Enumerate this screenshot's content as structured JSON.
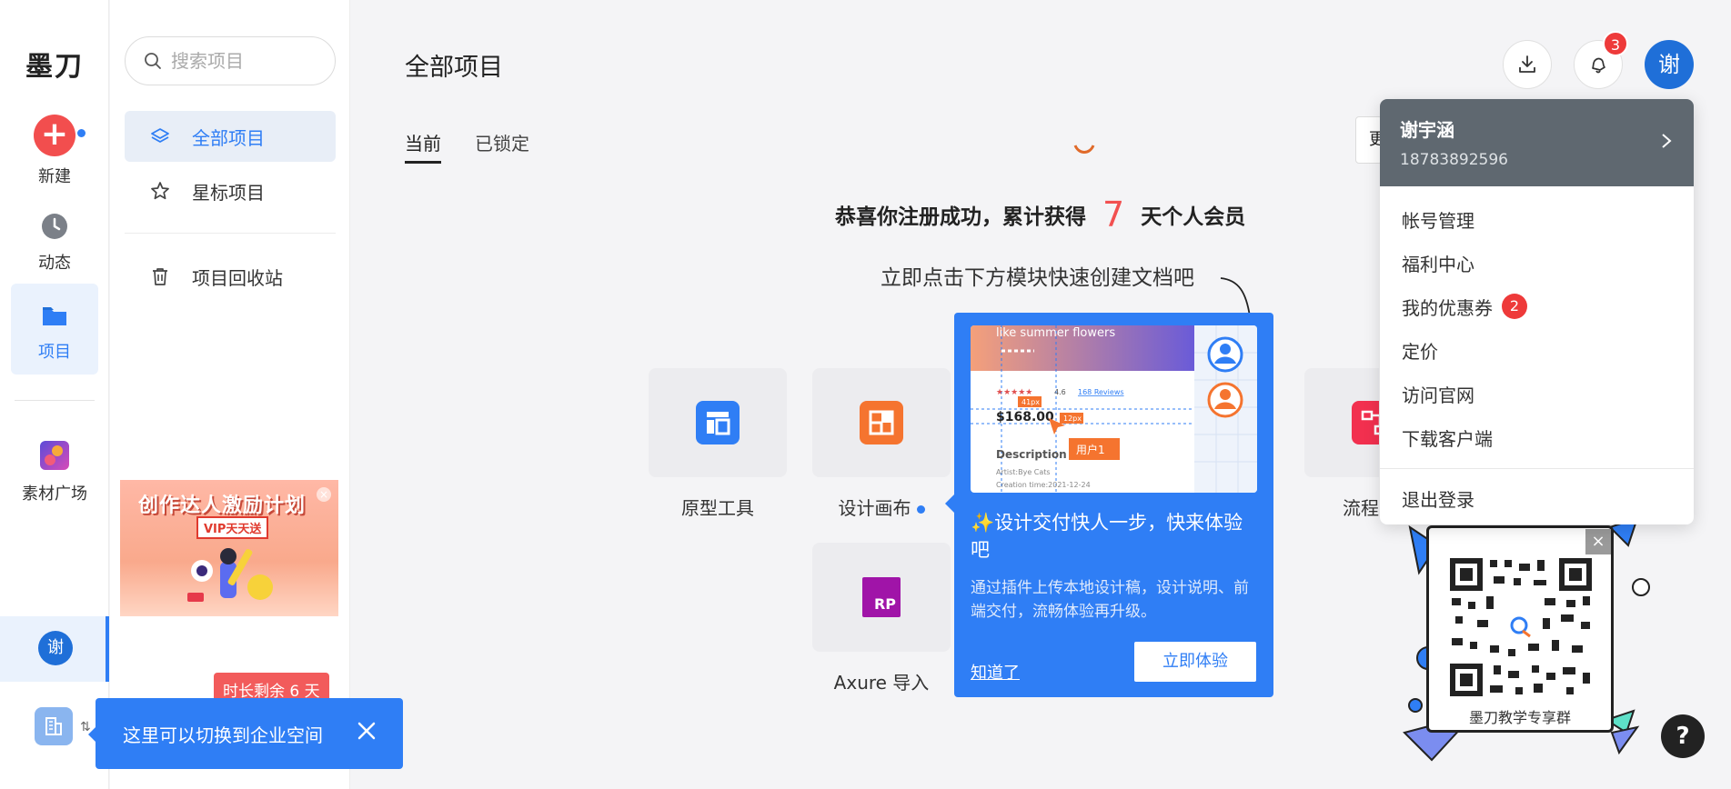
{
  "app": {
    "logo": "墨刀"
  },
  "rail": {
    "new_label": "新建",
    "activity_label": "动态",
    "projects_label": "项目",
    "assets_label": "素材广场",
    "user_avatar_text": "谢"
  },
  "sidebar": {
    "search_placeholder": "搜索项目",
    "items": [
      {
        "label": "全部项目",
        "icon": "layers-icon",
        "active": true
      },
      {
        "label": "星标项目",
        "icon": "star-icon",
        "active": false
      },
      {
        "label": "项目回收站",
        "icon": "trash-icon",
        "active": false
      }
    ],
    "banner": {
      "title": "创作达人激励计划",
      "tag": "VIP天天送"
    },
    "time_remaining": "时长剩余 6 天"
  },
  "toast": {
    "text": "这里可以切换到企业空间"
  },
  "main": {
    "title": "全部项目",
    "tabs": [
      {
        "label": "当前",
        "active": true
      },
      {
        "label": "已锁定",
        "active": false
      }
    ],
    "more_label": "更",
    "congrats": {
      "prefix": "恭喜你注册成功，累计获得",
      "days": "7",
      "suffix": "天个人会员"
    },
    "hint": "立即点击下方模块快速创建文档吧",
    "tools": [
      {
        "label": "原型工具",
        "icon": "prototype-icon",
        "color": "#2f7ef5"
      },
      {
        "label": "设计画布",
        "icon": "canvas-icon",
        "color": "#f5742f"
      },
      {
        "label": "Axure 导入",
        "icon": "axure-rp-icon",
        "icon_text": "RP",
        "color": "#a014a8"
      },
      {
        "label": "流程",
        "icon": "flow-icon",
        "color": "#f2304f"
      }
    ]
  },
  "header": {
    "notif_count": "3",
    "avatar_text": "谢"
  },
  "popup": {
    "preview": {
      "headline": "like summer flowers",
      "rating": "4.6",
      "reviews": "168 Reviews",
      "price": "$168.00",
      "dim1": "41px",
      "dim2": "12px",
      "cursor_label": "用户1",
      "desc_head": "Description",
      "artist": "Artist:Bye Cats",
      "created": "Creation time:2021-12-24"
    },
    "title": "✨设计交付快人一步，快来体验吧",
    "desc": "通过插件上传本地设计稿，设计说明、前端交付，流畅体验再升级。",
    "dismiss": "知道了",
    "cta": "立即体验"
  },
  "user_menu": {
    "name": "谢宇涵",
    "phone": "18783892596",
    "items": [
      {
        "label": "帐号管理"
      },
      {
        "label": "福利中心"
      },
      {
        "label": "我的优惠券",
        "badge": "2"
      },
      {
        "label": "定价"
      },
      {
        "label": "访问官网"
      },
      {
        "label": "下载客户端"
      }
    ],
    "logout": "退出登录"
  },
  "qr": {
    "caption": "墨刀教学专享群"
  },
  "help": {
    "label": "?"
  }
}
